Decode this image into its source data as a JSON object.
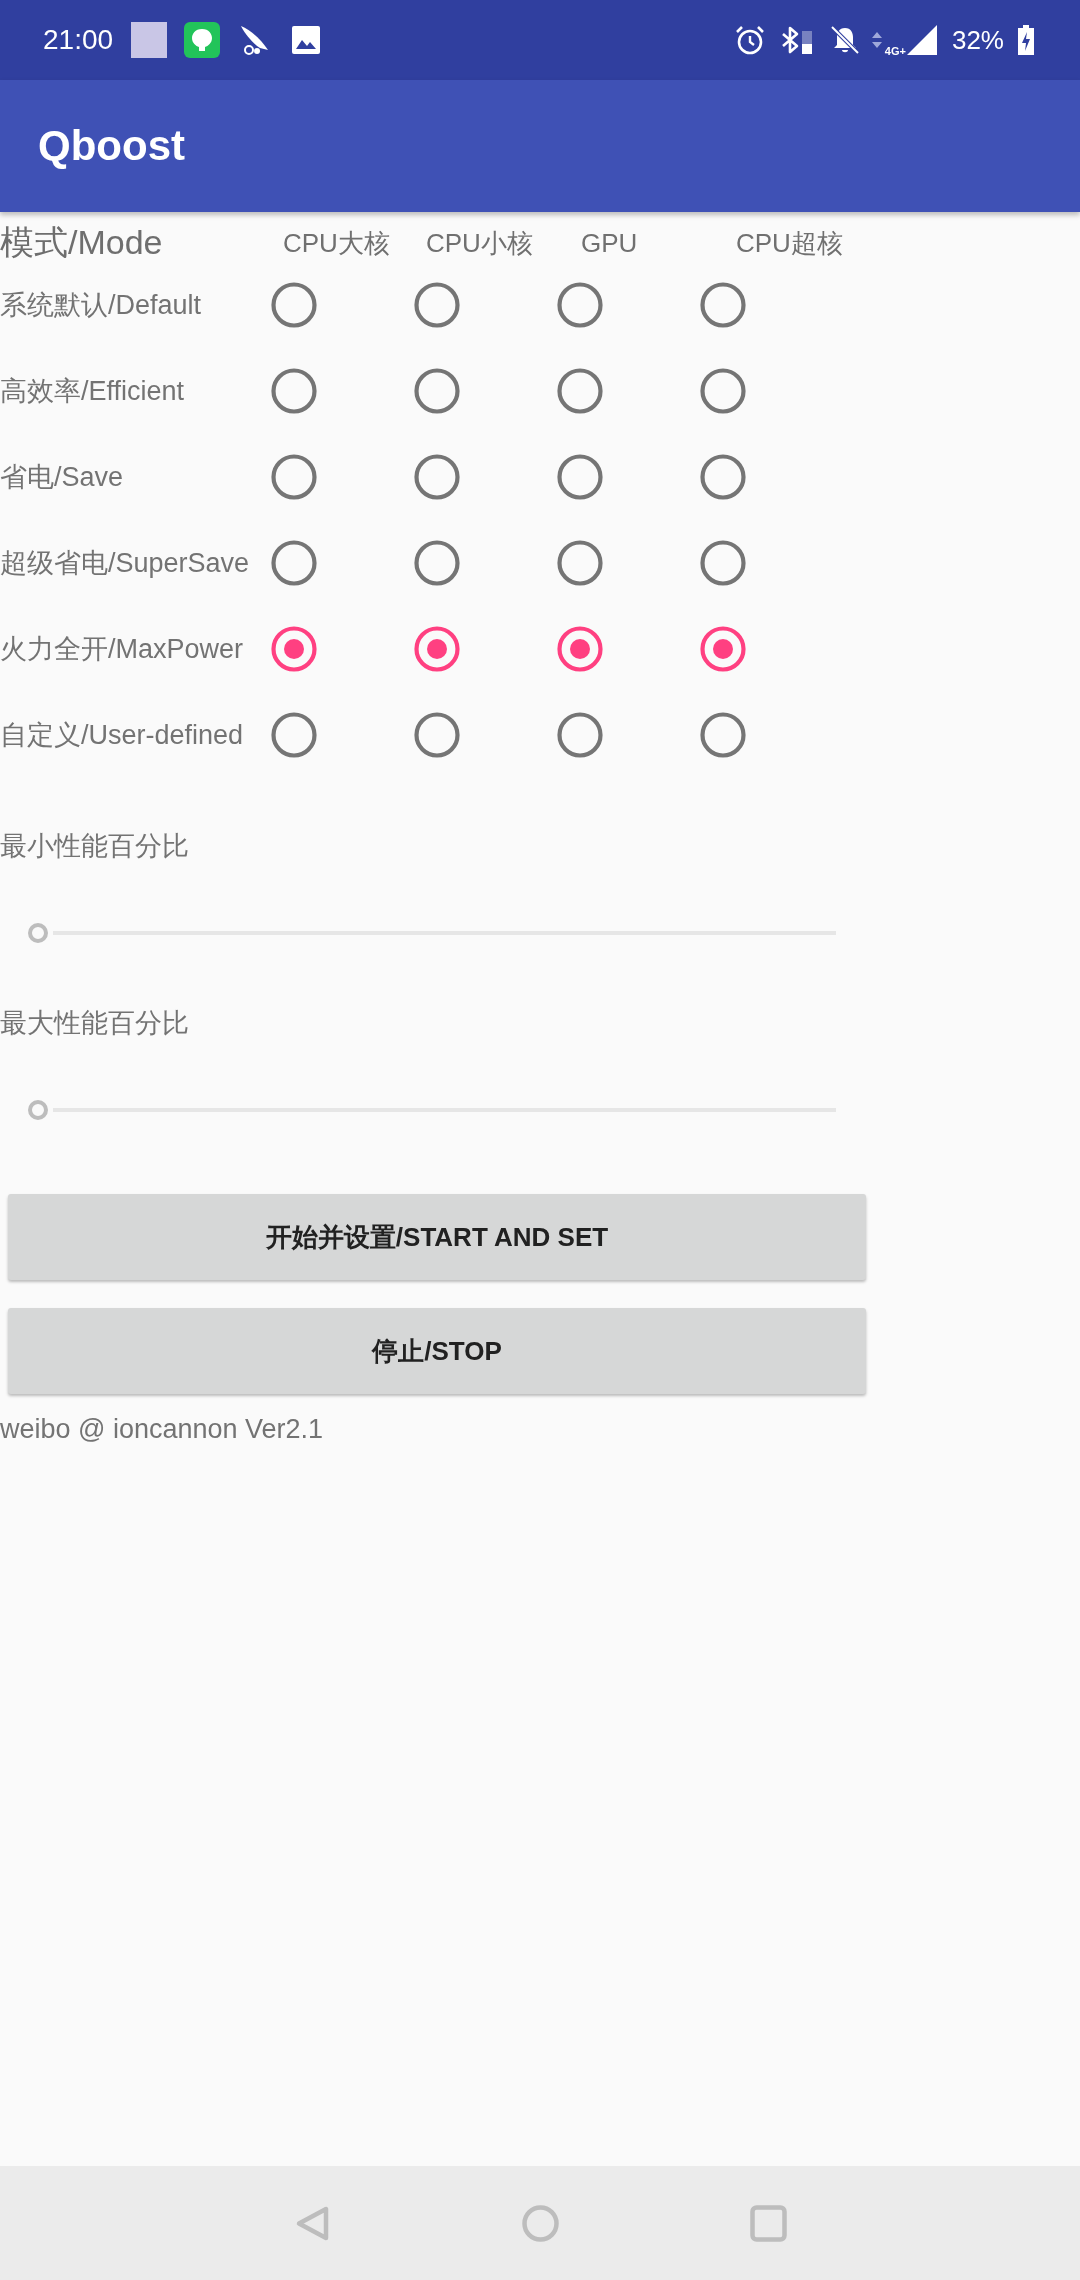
{
  "status_bar": {
    "time": "21:00",
    "network": "4G+",
    "battery": "32%"
  },
  "app_bar": {
    "title": "Qboost"
  },
  "mode_table": {
    "title": "模式/Mode",
    "columns": [
      "CPU大核",
      "CPU小核",
      "GPU",
      "CPU超核"
    ],
    "rows": [
      {
        "label": "系统默认/Default",
        "cells": [
          {
            "selected": false
          },
          {
            "selected": false
          },
          {
            "selected": false
          },
          {
            "selected": false
          }
        ]
      },
      {
        "label": "高效率/Efficient",
        "cells": [
          {
            "selected": false
          },
          {
            "selected": false
          },
          {
            "selected": false
          },
          {
            "selected": false
          }
        ]
      },
      {
        "label": "省电/Save",
        "cells": [
          {
            "selected": false
          },
          {
            "selected": false
          },
          {
            "selected": false
          },
          {
            "selected": false
          }
        ]
      },
      {
        "label": "超级省电/SuperSave",
        "cells": [
          {
            "selected": false
          },
          {
            "selected": false
          },
          {
            "selected": false
          },
          {
            "selected": false
          }
        ]
      },
      {
        "label": "火力全开/MaxPower",
        "cells": [
          {
            "selected": true
          },
          {
            "selected": true
          },
          {
            "selected": true
          },
          {
            "selected": true
          }
        ]
      },
      {
        "label": "自定义/User-defined",
        "cells": [
          {
            "selected": false
          },
          {
            "selected": false
          },
          {
            "selected": false
          },
          {
            "selected": false
          }
        ]
      }
    ]
  },
  "sliders": [
    {
      "label": "最小性能百分比",
      "level": 0
    },
    {
      "label": "最大性能百分比",
      "level": 0
    }
  ],
  "buttons": [
    "开始并设置/START AND SET",
    "停止/STOP"
  ],
  "footer": "weibo @ ioncannon Ver2.1"
}
